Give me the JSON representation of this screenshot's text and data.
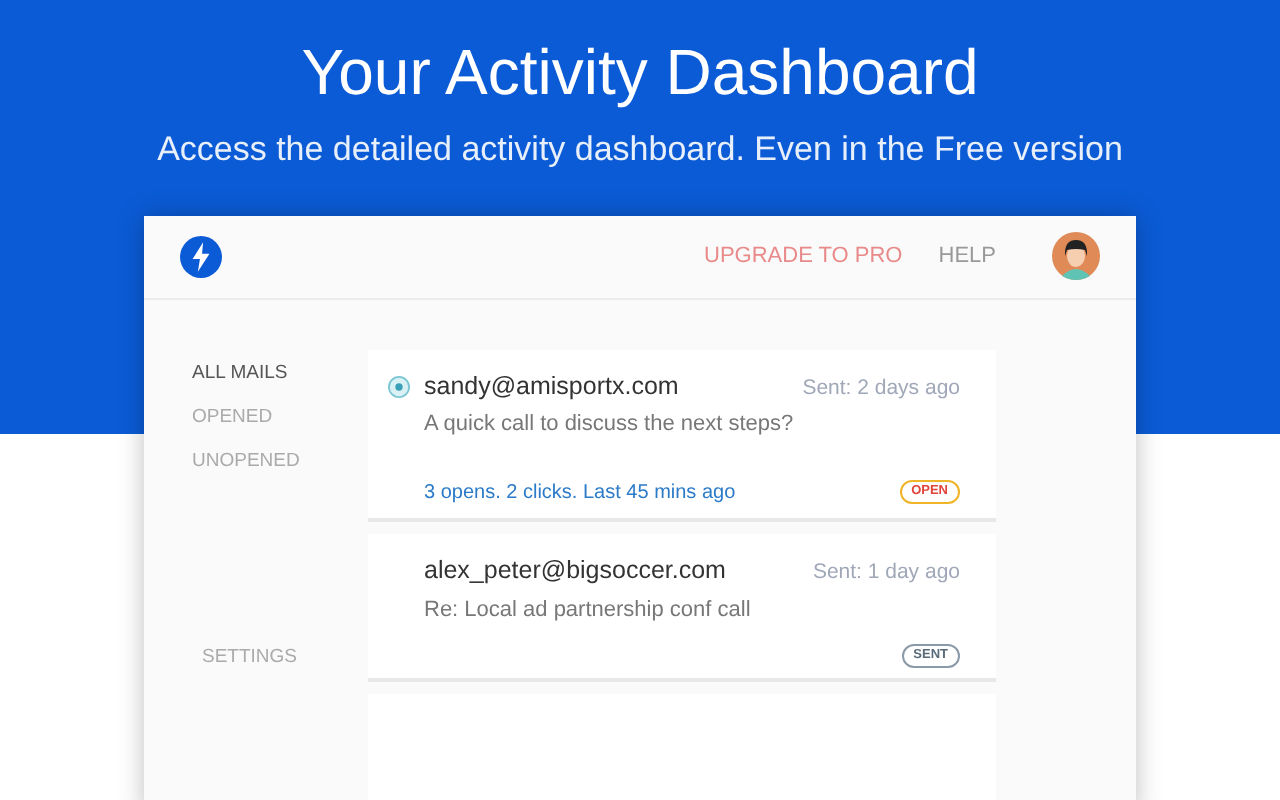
{
  "hero": {
    "title": "Your Activity Dashboard",
    "subtitle": "Access the detailed activity dashboard. Even in the Free version"
  },
  "header": {
    "links": [
      {
        "label": "UPGRADE TO PRO",
        "kind": "upgrade"
      },
      {
        "label": "HELP",
        "kind": "plain"
      }
    ]
  },
  "sidebar": {
    "items": [
      {
        "label": "ALL MAILS",
        "selected": true
      },
      {
        "label": "OPENED",
        "selected": false
      },
      {
        "label": "UNOPENED",
        "selected": false
      }
    ],
    "settings": "SETTINGS"
  },
  "mails": [
    {
      "sender": "sandy@amisportx.com",
      "sent": "Sent: 2 days ago",
      "subject": "A quick call to discuss the next steps?",
      "stats": "3 opens. 2 clicks. Last 45 mins ago",
      "badge": {
        "label": "OPEN",
        "kind": "open"
      },
      "has_icon": true
    },
    {
      "sender": "alex_peter@bigsoccer.com",
      "sent": "Sent: 1 day ago",
      "subject": "Re: Local ad partnership conf call",
      "badge": {
        "label": "SENT",
        "kind": "sent"
      },
      "has_icon": false
    }
  ]
}
